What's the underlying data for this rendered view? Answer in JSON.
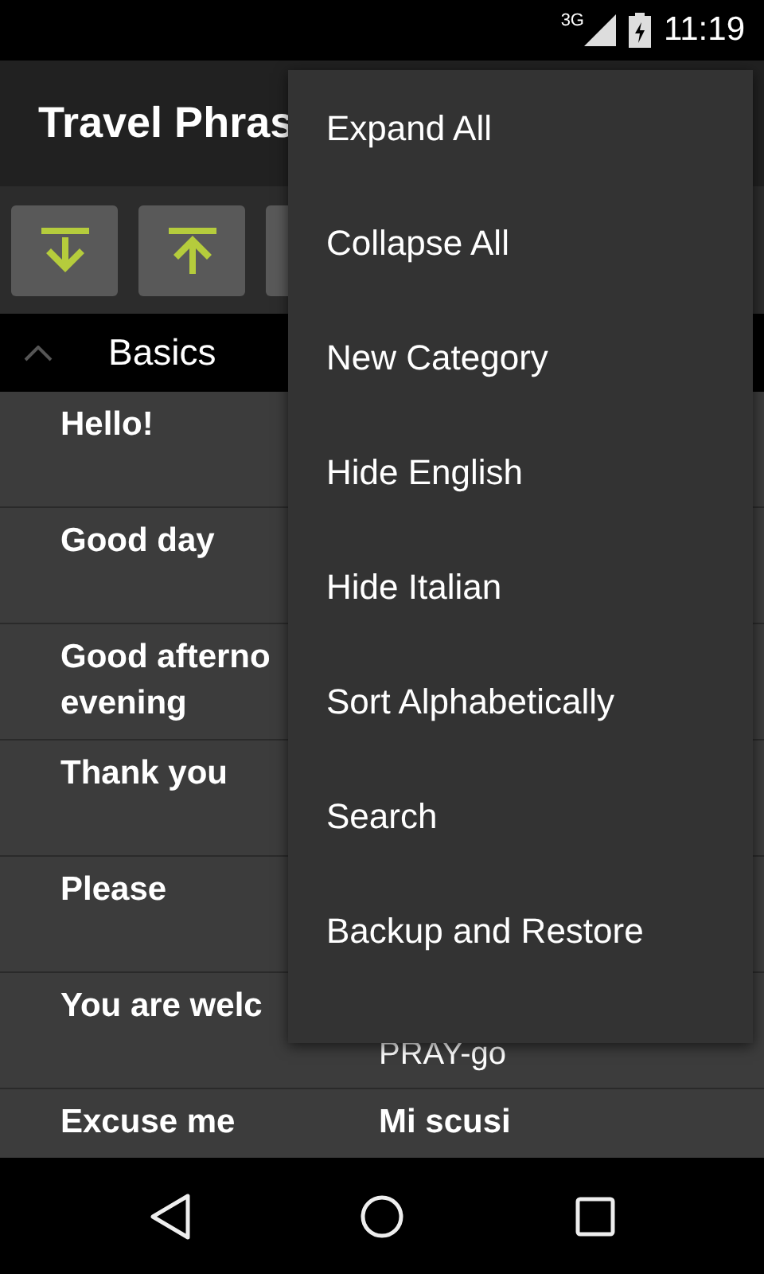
{
  "status_bar": {
    "network": "3G",
    "time": "11:19"
  },
  "app_bar": {
    "title": "Travel Phras"
  },
  "toolbar": [
    {
      "kind": "expand"
    },
    {
      "kind": "collapse"
    },
    {
      "kind": "hidden"
    }
  ],
  "category": {
    "name": "Basics",
    "expanded": true
  },
  "phrases": [
    {
      "english": [
        "Hello!"
      ]
    },
    {
      "english": [
        "Good day"
      ]
    },
    {
      "english": [
        "Good afterno",
        "evening"
      ]
    },
    {
      "english": [
        "Thank you"
      ]
    },
    {
      "english": [
        "Please"
      ]
    },
    {
      "english": [
        "You are welc"
      ],
      "pronunciation": "PRAY-go"
    },
    {
      "english": [
        "Excuse me"
      ],
      "italian": "Mi scusi"
    }
  ],
  "menu": {
    "items": [
      "Expand All",
      "Collapse All",
      "New Category",
      "Hide English",
      "Hide Italian",
      "Sort Alphabetically",
      "Search",
      "Backup and Restore"
    ]
  }
}
